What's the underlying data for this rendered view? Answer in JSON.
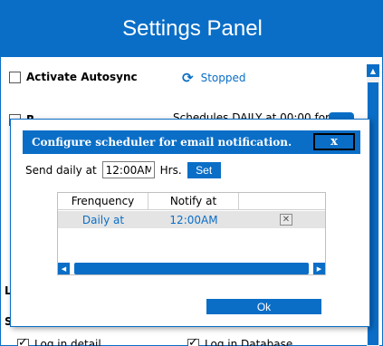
{
  "panel": {
    "title": "Settings Panel",
    "activate_autosync_label": "Activate Autosync",
    "status_text": "Stopped",
    "status_icon": "refresh-icon",
    "second_check_label": "R",
    "schedule_text": "Schedules DAILY at 00:00 for 1",
    "section_l": "L",
    "section_s": "S",
    "log_in_detail": "Log in detail",
    "log_in_database": "Log in Database"
  },
  "dialog": {
    "title": "Configure scheduler for email notification.",
    "close_label": "x",
    "send_daily_label": "Send daily at",
    "time_value": "12:00AM",
    "hrs_label": "Hrs.",
    "set_label": "Set",
    "ok_label": "Ok",
    "grid": {
      "columns": [
        "Frenquency",
        "Notify at"
      ],
      "rows": [
        {
          "frequency": "Daily at",
          "notify_at": "12:00AM"
        }
      ]
    }
  },
  "colors": {
    "accent": "#0a6ec7"
  }
}
